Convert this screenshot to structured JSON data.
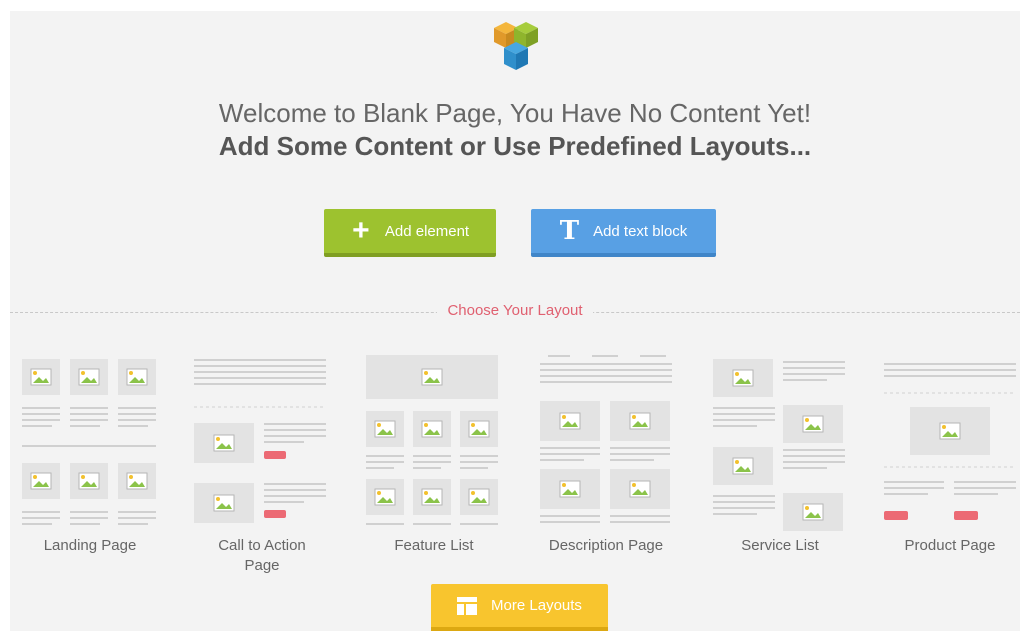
{
  "header": {
    "welcome_line": "Welcome to Blank Page, You Have No Content Yet!",
    "subtitle_line": "Add Some Content or Use Predefined Layouts..."
  },
  "actions": {
    "add_element_label": "Add element",
    "add_text_block_label": "Add text block",
    "more_layouts_label": "More Layouts"
  },
  "layouts_section": {
    "heading": "Choose Your Layout",
    "items": [
      {
        "label": "Landing Page"
      },
      {
        "label": "Call to Action Page"
      },
      {
        "label": "Feature List"
      },
      {
        "label": "Description Page"
      },
      {
        "label": "Service List"
      },
      {
        "label": "Product Page"
      }
    ]
  },
  "colors": {
    "add_element": "#9dc22f",
    "add_text_block": "#58a0e4",
    "more_layouts": "#f8c52e",
    "accent_heading": "#e06070",
    "cta_marker": "#ec6a74"
  },
  "icons": {
    "logo": "composer-logo-icon",
    "add_element": "plus-icon",
    "add_text_block": "text-t-icon",
    "more_layouts": "layout-grid-icon"
  }
}
